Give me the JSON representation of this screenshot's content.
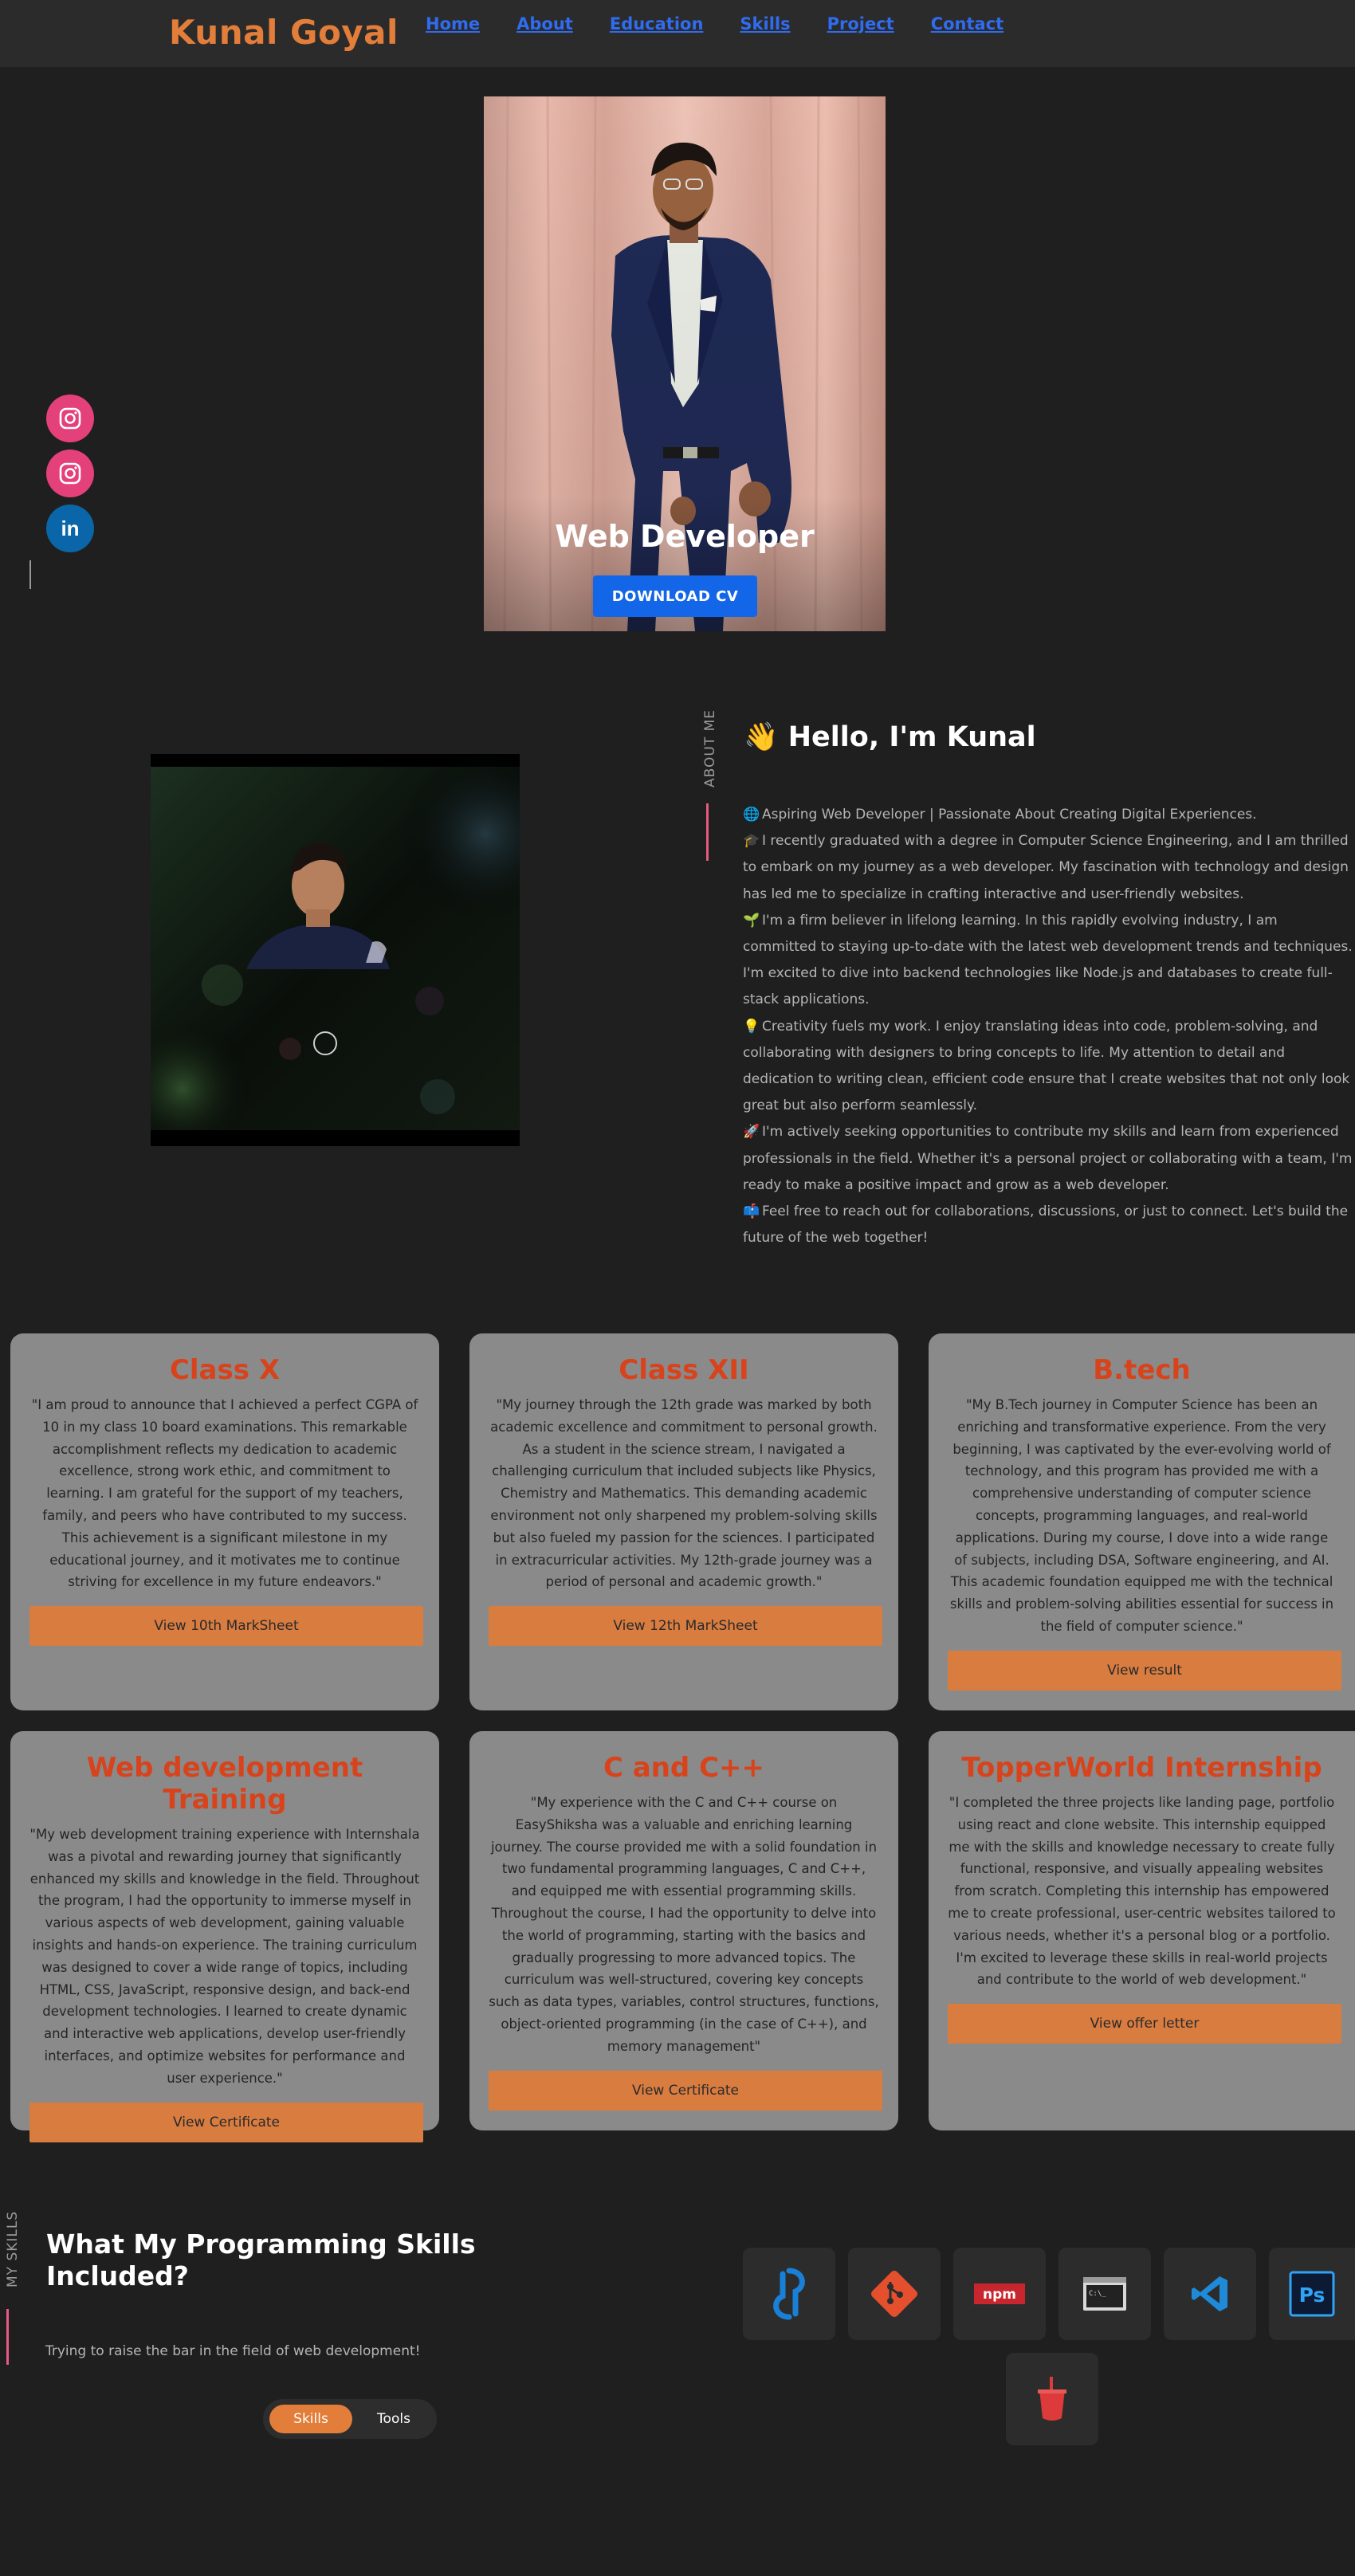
{
  "brand": "Kunal Goyal",
  "nav": [
    "Home",
    "About",
    "Education",
    "Skills",
    "Project",
    "Contact"
  ],
  "hero": {
    "role": "Web Developer",
    "cta": "DOWNLOAD CV"
  },
  "social": {
    "icons": [
      "instagram-icon",
      "instagram-icon",
      "linkedin-icon"
    ],
    "linkedin_text": "in"
  },
  "about": {
    "side_label": "ABOUT ME",
    "greeting": "👋 Hello, I'm Kunal",
    "paragraphs": [
      {
        "emoji": "🌐",
        "text": "Aspiring Web Developer | Passionate About Creating Digital Experiences."
      },
      {
        "emoji": "🎓",
        "text": "I recently graduated with a degree in Computer Science Engineering, and I am thrilled to embark on my journey as a web developer. My fascination with technology and design has led me to specialize in crafting interactive and user-friendly websites."
      },
      {
        "emoji": "🌱",
        "text": "I'm a firm believer in lifelong learning. In this rapidly evolving industry, I am committed to staying up-to-date with the latest web development trends and techniques. I'm excited to dive into backend technologies like Node.js and databases to create full-stack applications."
      },
      {
        "emoji": "💡",
        "text": "Creativity fuels my work. I enjoy translating ideas into code, problem-solving, and collaborating with designers to bring concepts to life. My attention to detail and dedication to writing clean, efficient code ensure that I create websites that not only look great but also perform seamlessly."
      },
      {
        "emoji": "🚀",
        "text": "I'm actively seeking opportunities to contribute my skills and learn from experienced professionals in the field. Whether it's a personal project or collaborating with a team, I'm ready to make a positive impact and grow as a web developer."
      },
      {
        "emoji": "📫",
        "text": "Feel free to reach out for collaborations, discussions, or just to connect. Let's build the future of the web together!"
      }
    ]
  },
  "education": [
    {
      "title": "Class X",
      "text": "\"I am proud to announce that I achieved a perfect CGPA of 10 in my class 10 board examinations. This remarkable accomplishment reflects my dedication to academic excellence, strong work ethic, and commitment to learning. I am grateful for the support of my teachers, family, and peers who have contributed to my success. This achievement is a significant milestone in my educational journey, and it motivates me to continue striving for excellence in my future endeavors.\"",
      "button": "View 10th MarkSheet"
    },
    {
      "title": "Class XII",
      "text": "\"My journey through the 12th grade was marked by both academic excellence and commitment to personal growth. As a student in the science stream, I navigated a challenging curriculum that included subjects like Physics, Chemistry and Mathematics. This demanding academic environment not only sharpened my problem-solving skills but also fueled my passion for the sciences. I participated in extracurricular activities. My 12th-grade journey was a period of personal and academic growth.\"",
      "button": "View 12th MarkSheet"
    },
    {
      "title": "B.tech",
      "text": "\"My B.Tech journey in Computer Science has been an enriching and transformative experience. From the very beginning, I was captivated by the ever-evolving world of technology, and this program has provided me with a comprehensive understanding of computer science concepts, programming languages, and real-world applications. During my course, I dove into a wide range of subjects, including DSA, Software engineering, and AI. This academic foundation equipped me with the technical skills and problem-solving abilities essential for success in the field of computer science.\"",
      "button": "View result"
    },
    {
      "title": "Web development Training",
      "text": "\"My web development training experience with Internshala was a pivotal and rewarding journey that significantly enhanced my skills and knowledge in the field. Throughout the program, I had the opportunity to immerse myself in various aspects of web development, gaining valuable insights and hands-on experience. The training curriculum was designed to cover a wide range of topics, including HTML, CSS, JavaScript, responsive design, and back-end development technologies. I learned to create dynamic and interactive web applications, develop user-friendly interfaces, and optimize websites for performance and user experience.\"",
      "button": "View Certificate"
    },
    {
      "title": "C and C++",
      "text": "\"My experience with the C and C++ course on EasyShiksha was a valuable and enriching learning journey. The course provided me with a solid foundation in two fundamental programming languages, C and C++, and equipped me with essential programming skills. Throughout the course, I had the opportunity to delve into the world of programming, starting with the basics and gradually progressing to more advanced topics. The curriculum was well-structured, covering key concepts such as data types, variables, control structures, functions, object-oriented programming (in the case of C++), and memory management\"",
      "button": "View Certificate"
    },
    {
      "title": "TopperWorld Internship",
      "text": "\"I completed the three projects like landing page, portfolio using react and clone website. This internship equipped me with the skills and knowledge necessary to create fully functional, responsive, and visually appealing websites from scratch. Completing this internship has empowered me to create professional, user-centric websites tailored to various needs, whether it's a personal blog or a portfolio. I'm excited to leverage these skills in real-world projects and contribute to the world of web development.\"",
      "button": "View offer letter"
    }
  ],
  "skills": {
    "side_label": "MY SKILLS",
    "title": "What My Programming Skills Included?",
    "subtitle": "Trying to raise the bar in the field of web development!",
    "toggle": {
      "active": "Skills",
      "inactive": "Tools"
    },
    "tools": [
      {
        "icon": "sourcetree-icon"
      },
      {
        "icon": "git-icon"
      },
      {
        "icon": "npm-icon",
        "label": "npm"
      },
      {
        "icon": "terminal-icon",
        "label": "C:\\_"
      },
      {
        "icon": "vscode-icon"
      },
      {
        "icon": "photoshop-icon",
        "label": "Ps"
      },
      {
        "icon": "gulp-icon"
      }
    ]
  },
  "colors": {
    "background": "#1f1f1f",
    "navbar": "#2b2b2b",
    "brand": "#e27d3a",
    "nav_link": "#2f6cf0",
    "card": "#8a8a8a",
    "card_title": "#d8431b",
    "card_button": "#d97c40",
    "accent_pink": "#e65a83",
    "cta_blue": "#1366e8"
  }
}
